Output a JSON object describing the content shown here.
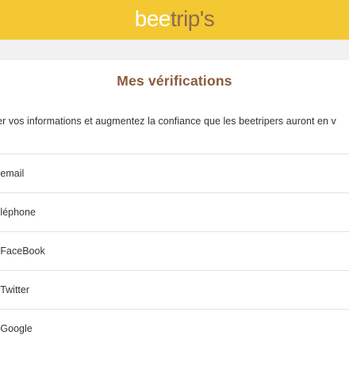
{
  "header": {
    "logo_part1": "bee",
    "logo_part2": "trip's",
    "bg_color": "#f3c832"
  },
  "page": {
    "title": "Mes vérifications",
    "intro": "ifier vos informations et augmentez la confiance que les beetripers auront en v"
  },
  "verifications": [
    {
      "label": "n email"
    },
    {
      "label": "téléphone"
    },
    {
      "label": "n FaceBook"
    },
    {
      "label": "n Twitter"
    },
    {
      "label": "n Google"
    }
  ]
}
